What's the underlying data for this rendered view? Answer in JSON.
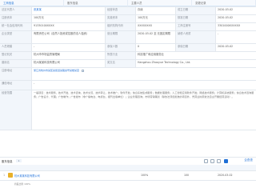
{
  "tabs": [
    "工商信息",
    "股东信息",
    "主要人员",
    "变更记录"
  ],
  "rows": {
    "r1": {
      "l1": "法定代表人",
      "v1": "张某某",
      "l2": "经营状态",
      "v2": "存续",
      "l3": "成立日期",
      "v3": "2020-03-02"
    },
    "r2": {
      "l1": "注册资本",
      "v1": "100万元",
      "l2": "实缴资本",
      "v2": "100万元",
      "l3": "核准日期",
      "v3": "2020-03-02"
    },
    "r3": {
      "l1": "统一社会信用代码",
      "v1": "91330100XXXX",
      "l2": "组织机构代码",
      "v2": "XXXXXXXX",
      "l3": "工商注册号",
      "v3": "3301000XXXXXX"
    },
    "r4": {
      "l1": "企业类型",
      "v1": "有限责任公司（自然人投资或控股的法人独资）",
      "l2": "营业期限",
      "v2": "2020-03-02 至 无固定期限",
      "l3": "纳税人资质",
      "v3": "-"
    },
    "r5": {
      "l1": "人员规模",
      "v1": "-",
      "l2": "参保人数",
      "v2": "0",
      "l3": "参保日期",
      "v3": "2020-03-02"
    },
    "r6": {
      "l1": "登记机关",
      "v1": "杭州市市场监督管理局",
      "l2": "所属行业",
      "v2": "科技推广和应用服务业"
    },
    "r7": {
      "l1": "曾用名",
      "v1": "杭州某某科技有限公司",
      "l2": "英文名",
      "v2": "Hangzhou Zhaoyue Technology Co., Ltd."
    },
    "r8": {
      "l1": "注册地址",
      "v1": "浙江省杭州市某区某街道某路某号某楼某室"
    },
    "r9": {
      "l1": "通信地址",
      "v1": "-"
    },
    "r10": {
      "l1": "经营范围",
      "v1": "一般项目：技术服务、技术开发、技术咨询、技术交流、技术转让、技术推广；软件开发；信息系统集成服务；数据处理服务；人工智能应用软件开发；网络技术服务；计算机系统服务；信息技术咨询服务；广告设计、代理；广告制作；广告发布（非广播电台、电视台、报刊出版单位）；企业管理咨询；市场营销策划（除依法须经批准的项目外，凭营业执照依法自主开展经营活动）。"
    }
  },
  "shareholders": {
    "title": "股东信息",
    "count": "1",
    "brand": "企查查",
    "rows": [
      {
        "index": "1",
        "name": "杭州某某科技有限公司",
        "ratio": "100%",
        "amount": "100",
        "date": "2020-03-02",
        "note": "持股比例 100%"
      }
    ]
  }
}
